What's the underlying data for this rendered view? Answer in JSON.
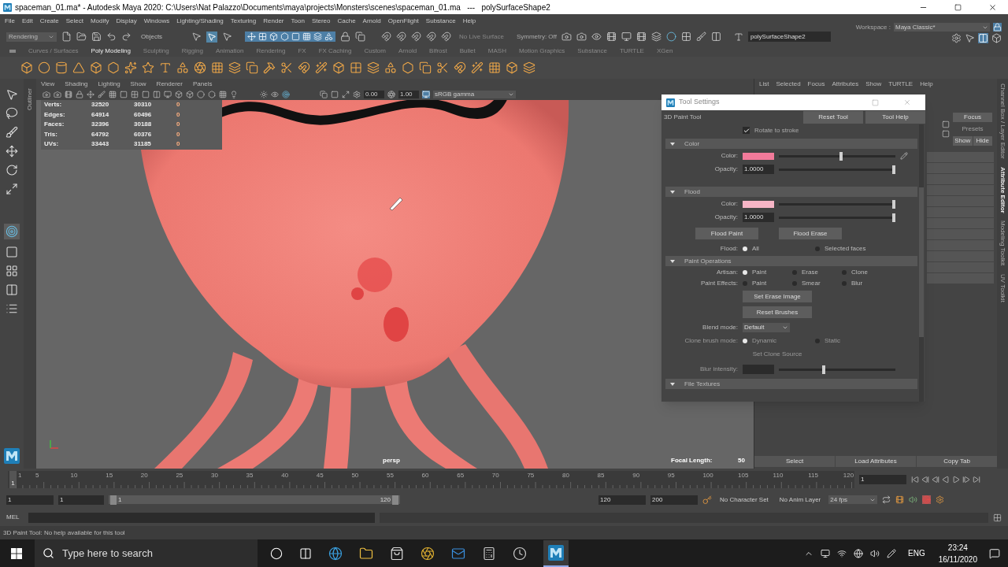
{
  "window": {
    "title": "spaceman_01.ma* - Autodesk Maya 2020: C:\\Users\\Nat Palazzo\\Documents\\maya\\projects\\Monsters\\scenes\\spaceman_01.ma   ---   polySurfaceShape2"
  },
  "menu": [
    "File",
    "Edit",
    "Create",
    "Select",
    "Modify",
    "Display",
    "Windows",
    "Lighting/Shading",
    "Texturing",
    "Render",
    "Toon",
    "Stereo",
    "Cache",
    "Arnold",
    "OpenFlight",
    "Substance",
    "Help"
  ],
  "status_line": {
    "mode": "Rendering",
    "selection_mode": "Objects",
    "live_surface": "No Live Surface",
    "symmetry": "Symmetry: Off",
    "name_field": "polySurfaceShape2",
    "workspace_label": "Workspace :",
    "workspace": "Maya Classic*"
  },
  "shelf_tabs": [
    {
      "label": "Curves / Surfaces",
      "selected": false
    },
    {
      "label": "Poly Modeling",
      "selected": true
    },
    {
      "label": "Sculpting",
      "selected": false
    },
    {
      "label": "Rigging",
      "selected": false
    },
    {
      "label": "Animation",
      "selected": false
    },
    {
      "label": "Rendering",
      "selected": false
    },
    {
      "label": "FX",
      "selected": false
    },
    {
      "label": "FX Caching",
      "selected": false
    },
    {
      "label": "Custom",
      "selected": false
    },
    {
      "label": "Arnold",
      "selected": false
    },
    {
      "label": "Bifrost",
      "selected": false
    },
    {
      "label": "Bullet",
      "selected": false
    },
    {
      "label": "MASH",
      "selected": false
    },
    {
      "label": "Motion Graphics",
      "selected": false
    },
    {
      "label": "Substance",
      "selected": false
    },
    {
      "label": "TURTLE",
      "selected": false
    },
    {
      "label": "XGen",
      "selected": false
    }
  ],
  "outliner_tab": "Outliner",
  "viewport": {
    "menu": [
      "View",
      "Shading",
      "Lighting",
      "Show",
      "Renderer",
      "Panels"
    ],
    "exposure": "0.00",
    "gamma": "1.00",
    "color_space": "sRGB gamma",
    "hud_stats": [
      {
        "label": "Verts:",
        "values": [
          "32520",
          "30310",
          "0"
        ]
      },
      {
        "label": "Edges:",
        "values": [
          "64914",
          "60496",
          "0"
        ]
      },
      {
        "label": "Faces:",
        "values": [
          "32396",
          "30188",
          "0"
        ]
      },
      {
        "label": "Tris:",
        "values": [
          "64792",
          "60376",
          "0"
        ]
      },
      {
        "label": "UVs:",
        "values": [
          "33443",
          "31185",
          "0"
        ]
      }
    ],
    "camera": "persp",
    "focal_length_label": "Focal Length:",
    "focal_length": "50"
  },
  "tool_settings": {
    "title": "Tool Settings",
    "tool": "3D Paint Tool",
    "buttons": [
      "Reset Tool",
      "Tool Help"
    ],
    "rotate_to_stroke": {
      "label": "Rotate to stroke",
      "checked": true
    },
    "sections": [
      {
        "title": "Color",
        "expanded": true,
        "rows": [
          {
            "kind": "color",
            "label": "Color:",
            "color": "#f27a9a",
            "level": 0.55,
            "disabled": false
          },
          {
            "kind": "number",
            "label": "Opacity:",
            "value": "1.0000",
            "level": 1,
            "disabled": false
          }
        ]
      },
      {
        "title": "Flood",
        "expanded": true,
        "rows": [
          {
            "kind": "color",
            "label": "Color:",
            "color": "#f7b5c6",
            "level": 1,
            "disabled": false
          },
          {
            "kind": "number",
            "label": "Opacity:",
            "value": "1.0000",
            "level": 1,
            "disabled": false
          },
          {
            "kind": "buttons",
            "buttons": [
              "Flood Paint",
              "Flood Erase"
            ],
            "disabled": false
          },
          {
            "kind": "radio",
            "label": "Flood:",
            "options": [
              {
                "label": "All",
                "selected": true
              },
              {
                "label": "Selected faces",
                "selected": false
              }
            ],
            "disabled": false
          }
        ]
      },
      {
        "title": "Paint Operations",
        "expanded": true,
        "rows": [
          {
            "kind": "radio",
            "label": "Artisan:",
            "options": [
              {
                "label": "Paint",
                "selected": true
              },
              {
                "label": "Erase",
                "selected": false
              },
              {
                "label": "Clone",
                "selected": false
              }
            ],
            "disabled": false
          },
          {
            "kind": "radio",
            "label": "Paint Effects:",
            "options": [
              {
                "label": "Paint",
                "selected": false
              },
              {
                "label": "Smear",
                "selected": false
              },
              {
                "label": "Blur",
                "selected": false
              }
            ],
            "disabled": false
          },
          {
            "kind": "button",
            "label": "Set Erase Image",
            "disabled": false
          },
          {
            "kind": "button",
            "label": "Reset Brushes",
            "disabled": false
          },
          {
            "kind": "dropdown",
            "label": "Blend mode:",
            "value": "Default",
            "disabled": false
          },
          {
            "kind": "radio",
            "label": "Clone brush mode:",
            "options": [
              {
                "label": "Dynamic",
                "selected": true
              },
              {
                "label": "Static",
                "selected": false
              }
            ],
            "disabled": true
          },
          {
            "kind": "button",
            "label": "Set Clone Source",
            "disabled": true
          },
          {
            "kind": "slider",
            "label": "Blur intensity:",
            "level": 0.4,
            "disabled": true
          }
        ]
      },
      {
        "title": "File Textures",
        "expanded": true
      }
    ]
  },
  "attribute_editor": {
    "menu": [
      "List",
      "Selected",
      "Focus",
      "Attributes",
      "Show",
      "TURTLE",
      "Help"
    ],
    "buttons": [
      {
        "label": "Focus",
        "disabled": false
      },
      {
        "label": "Presets",
        "disabled": true
      }
    ],
    "show_hide": [
      "Show",
      "Hide"
    ],
    "bottom_buttons": [
      "Select",
      "Load Attributes",
      "Copy Tab"
    ]
  },
  "side_tabs": [
    {
      "label": "Channel Box / Layer Editor",
      "selected": false
    },
    {
      "label": "Attribute Editor",
      "selected": true
    },
    {
      "label": "Modeling Toolkit",
      "selected": false
    },
    {
      "label": "UV Toolkit",
      "selected": false
    }
  ],
  "timeline": {
    "start": "1",
    "ticks": [
      "5",
      "10",
      "15",
      "20",
      "25",
      "30",
      "35",
      "40",
      "45",
      "50",
      "55",
      "60",
      "65",
      "70",
      "75",
      "80",
      "85",
      "90",
      "95",
      "100",
      "105",
      "110",
      "115",
      "120"
    ],
    "current_frame": "1",
    "current_frame_field": "1"
  },
  "range": {
    "start": "1",
    "playback_start": "1",
    "bar_start": "1",
    "bar_end": "120",
    "playback_end": "120",
    "end": "200",
    "character_set": "No Character Set",
    "anim_layer": "No Anim Layer",
    "fps": "24 fps"
  },
  "command_line": {
    "label": "MEL"
  },
  "help_line": "3D Paint Tool: No help available for this tool",
  "taskbar": {
    "search_placeholder": "Type here to search",
    "language": "ENG",
    "time": "23:24",
    "date": "16/11/2020"
  }
}
